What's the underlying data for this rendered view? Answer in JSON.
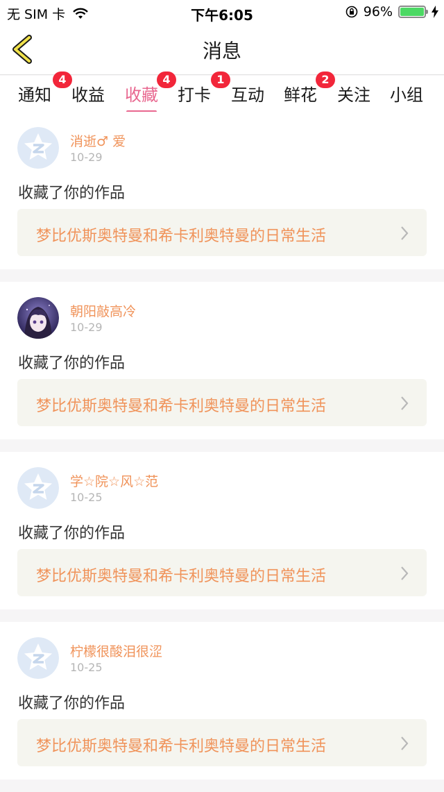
{
  "status_bar": {
    "carrier": "无 SIM 卡",
    "time": "下午6:05",
    "battery": "96%"
  },
  "nav": {
    "title": "消息"
  },
  "tabs": [
    {
      "label": "通知",
      "badge": "4"
    },
    {
      "label": "收益",
      "badge": ""
    },
    {
      "label": "收藏",
      "badge": "4",
      "active": true
    },
    {
      "label": "打卡",
      "badge": "1"
    },
    {
      "label": "互动",
      "badge": ""
    },
    {
      "label": "鲜花",
      "badge": "2"
    },
    {
      "label": "关注",
      "badge": ""
    },
    {
      "label": "小组",
      "badge": ""
    }
  ],
  "colors": {
    "accent": "#e8678f",
    "username": "#f0935a",
    "badge": "#f2263a"
  },
  "items": [
    {
      "username": "消逝♂ 爱",
      "date": "10-29",
      "action": "收藏了你的作品",
      "work_title": "梦比优斯奥特曼和希卡利奥特曼的日常生活",
      "avatar": "default-avatar-icon"
    },
    {
      "username": "朝阳敲高冷",
      "date": "10-29",
      "action": "收藏了你的作品",
      "work_title": "梦比优斯奥特曼和希卡利奥特曼的日常生活",
      "avatar": "anime-girl-avatar"
    },
    {
      "username": "学☆院☆风☆范",
      "date": "10-25",
      "action": "收藏了你的作品",
      "work_title": "梦比优斯奥特曼和希卡利奥特曼的日常生活",
      "avatar": "default-avatar-icon"
    },
    {
      "username": "柠檬很酸泪很涩",
      "date": "10-25",
      "action": "收藏了你的作品",
      "work_title": "梦比优斯奥特曼和希卡利奥特曼的日常生活",
      "avatar": "default-avatar-icon"
    }
  ]
}
